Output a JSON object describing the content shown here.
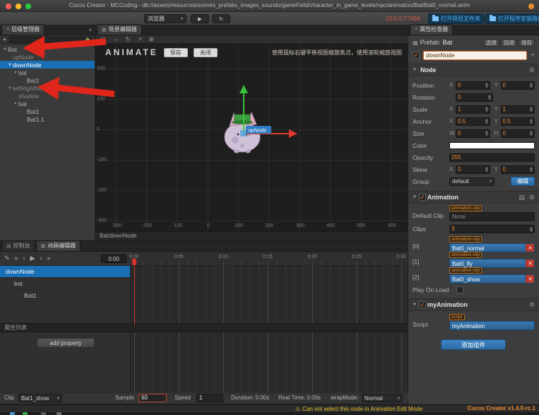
{
  "window": {
    "title": "Cocos Creator - MCCoding - db://assets/resources/scenes_prefabs_images_sounds/gameField/character_in_game_levels/npc/animation/Bat/Bat0_normal.anim"
  },
  "toolbar": {
    "preview_target": "浏览器",
    "ip": "10.0.0.7:7456",
    "open_project": "打开项目文件夹",
    "open_install": "打开程序安装路径"
  },
  "icons": {
    "menu": "≡",
    "grid": "▦",
    "list": "▤",
    "plus": "+",
    "gear": "⚙",
    "play": "▶",
    "refresh": "↻",
    "dropdown": "▾",
    "tri_down": "▼",
    "edit": "✎",
    "skip_start": "«",
    "step_back": "‹",
    "step_fwd": "›",
    "skip_end": "»",
    "check": "✓",
    "close": "✕",
    "warning": "⚠",
    "search_filter": "✚",
    "tool_select": "◻",
    "tool_move": "↔",
    "tool_rotate": "↻",
    "tool_scale": "↗",
    "tool_rect": "⊞"
  },
  "hierarchy": {
    "tab": "层级管理器",
    "nodes": [
      {
        "label": "Bat",
        "depth": 0,
        "selected": false
      },
      {
        "label": "upNode",
        "depth": 1,
        "selected": false
      },
      {
        "label": "downNode",
        "depth": 1,
        "selected": true
      },
      {
        "label": "bat",
        "depth": 2,
        "selected": false
      },
      {
        "label": "Bat1",
        "depth": 3,
        "selected": false
      },
      {
        "label": "leftRightNode",
        "depth": 1,
        "selected": false
      },
      {
        "label": "shadow",
        "depth": 2,
        "selected": false
      },
      {
        "label": "bat",
        "depth": 2,
        "selected": false
      },
      {
        "label": "Bat1",
        "depth": 3,
        "selected": false
      },
      {
        "label": "Bat1.1",
        "depth": 3,
        "selected": false
      }
    ]
  },
  "scene": {
    "tab": "场景编辑器",
    "mode_label": "ANIMATE",
    "save": "保存",
    "close": "关闭",
    "hint": "使用鼠标右键平移视图缩放焦点，使用滚轮缩放视图",
    "node_label": "upNode",
    "breadcrumb": "Bat/downNode",
    "v_ruler": [
      "200",
      "100",
      "0",
      "-100",
      "-200",
      "-300"
    ],
    "h_ruler": [
      "-300",
      "-200",
      "-100",
      "0",
      "100",
      "200",
      "300",
      "400",
      "500",
      "600"
    ]
  },
  "timeline": {
    "tab_console": "控制台",
    "tab_animation": "动画编辑器",
    "time": "0:00",
    "ruler": [
      "0:00",
      "0:05",
      "0:10",
      "0:15",
      "0:20",
      "0:25",
      "0:30"
    ],
    "tracks": [
      {
        "label": "downNode",
        "selected": true
      },
      {
        "label": "bat",
        "selected": false
      },
      {
        "label": "Bat1",
        "selected": false
      }
    ],
    "properties_header": "属性列表",
    "add_property": "add property",
    "clip_label": "Clip",
    "clip_value": "Bat1_show",
    "sample_label": "Sample",
    "sample_value": "60",
    "speed_label": "Speed",
    "speed_value": "1",
    "duration": "Duration: 0.00s",
    "real_time": "Real Time: 0.00s",
    "wrap_label": "wrapMode:",
    "wrap_value": "Normal"
  },
  "inspector": {
    "tab": "属性检查器",
    "prefab": {
      "label": "Prefab:",
      "value": "Bat",
      "actions": [
        "选择",
        "回退",
        "保存"
      ]
    },
    "name_field": "downNode",
    "axis": {
      "x": "X",
      "y": "Y",
      "w": "W",
      "h": "H"
    },
    "node": {
      "title": "Node",
      "position": {
        "label": "Position",
        "x": "0",
        "y": "0"
      },
      "rotation": {
        "label": "Rotation",
        "value": "0"
      },
      "scale": {
        "label": "Scale",
        "x": "1",
        "y": "1"
      },
      "anchor": {
        "label": "Anchor",
        "x": "0.5",
        "y": "0.5"
      },
      "size": {
        "label": "Size",
        "w": "0",
        "h": "0"
      },
      "color": {
        "label": "Color"
      },
      "opacity": {
        "label": "Opacity",
        "value": "255"
      },
      "skew": {
        "label": "Skew",
        "x": "0",
        "y": "0"
      },
      "group": {
        "label": "Group",
        "value": "default",
        "edit": "编辑"
      }
    },
    "animation": {
      "title": "Animation",
      "default_clip_label": "Default Clip",
      "clip_tag": "animation-clip",
      "default_clip_value": "None",
      "clips_label": "Clips",
      "clips_count": "3",
      "clips": [
        {
          "index": "[0]",
          "value": "Bat0_normal"
        },
        {
          "index": "[1]",
          "value": "Bat0_fly"
        },
        {
          "index": "[2]",
          "value": "Bat0_show"
        }
      ],
      "play_on_load": "Play On Load"
    },
    "script": {
      "title": "myAnimation",
      "label": "Script",
      "tag": "script",
      "value": "myAnimation"
    },
    "add_component": "添加组件"
  },
  "statusbar": {
    "warning": "Can not select this node in Animation Edit Mode",
    "version": "Cocos Creator v1.4.0-rc.1"
  },
  "colors": {
    "accent_blue": "#2e6da4",
    "selection_blue": "#1b6fb5",
    "value_orange": "#ef8b31",
    "warning_yellow": "#e7c12c",
    "annotation_red": "#e0261a"
  }
}
